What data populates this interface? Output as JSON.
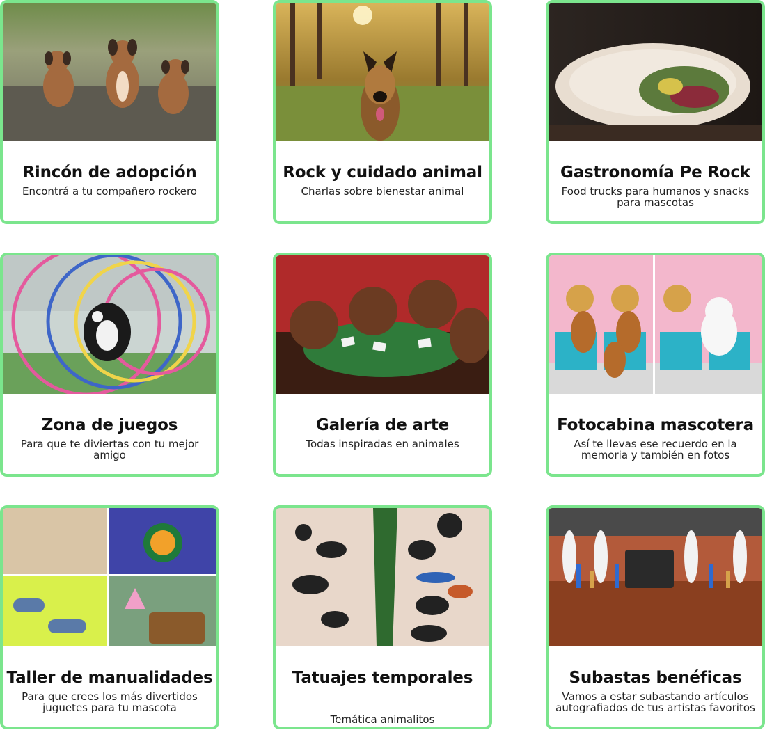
{
  "cards": [
    {
      "title": "Rincón de adopción",
      "description": "Encontrá a tu compañero rockero",
      "image_icon": "puppies-photo"
    },
    {
      "title": "Rock y cuidado animal",
      "description": "Charlas sobre bienestar animal",
      "image_icon": "dog-forest-photo"
    },
    {
      "title": "Gastronomía Pe Rock",
      "description": "Food trucks para humanos y snacks para mascotas",
      "image_icon": "burrito-photo"
    },
    {
      "title": "Zona de juegos",
      "description": "Para que te diviertas con tu mejor amigo",
      "image_icon": "dog-agility-photo"
    },
    {
      "title": "Galería de arte",
      "description": "Todas inspiradas en animales",
      "image_icon": "dogs-poker-painting"
    },
    {
      "title": "Fotocabina mascotera",
      "description": "Así te llevas ese recuerdo en la memoria y también en fotos",
      "image_icon": "pet-photobooth-photo"
    },
    {
      "title": "Taller de manualidades",
      "description": "Para que crees los más divertidos juguetes para tu mascota",
      "image_icon": "pet-crafts-collage"
    },
    {
      "title": "Tatuajes temporales",
      "description": "Temática animalitos",
      "image_icon": "animal-tattoos-photo"
    },
    {
      "title": "Subastas benéficas",
      "description": "Vamos a estar subastando artículos autografiados de tus artistas favoritos",
      "image_icon": "auction-room-photo"
    }
  ],
  "colors": {
    "card_border": "#7be58d",
    "title_text": "#111111",
    "description_text": "#222222"
  }
}
